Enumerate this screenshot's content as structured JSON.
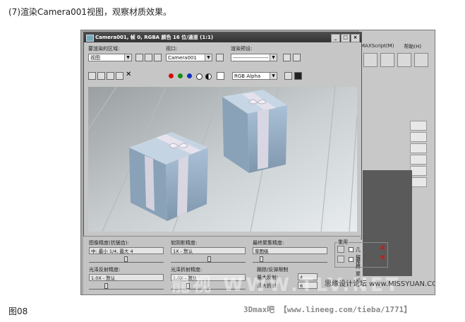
{
  "article": {
    "step_caption": "(7)渲染Camera001视图，观察材质效果。",
    "figure_caption": "图08",
    "footer_link": "3Dmax吧 【www.lineeg.com/tieba/1771】"
  },
  "background_app": {
    "menu": [
      "MAXScript(M)",
      "帮助(H)"
    ]
  },
  "render_window": {
    "title": "Camera001, 帧 0, RGBA 颜色 16 位/通道 (1:1)",
    "area_label": "要渲染的区域:",
    "area_value": "视图",
    "viewport_label": "视口:",
    "viewport_value": "Camera001",
    "preset_label": "渲染预设:",
    "preset_value": "--------------------",
    "channel_value": "RGB Alpha"
  },
  "settings": {
    "image_precision_label": "图像精度(抗锯齿):",
    "image_precision_value": "中: 最小 1/4, 最大 4",
    "soft_shadow_label": "软阴影精度:",
    "soft_shadow_value": "1X - 默认",
    "final_gather_label": "最终聚集精度:",
    "final_gather_value": "草图级",
    "reflection_label": "光泽反射精度:",
    "reflection_value": "1.0X - 默认",
    "refraction_label": "光泽折射精度:",
    "refraction_value": "1.0X - 默认",
    "trace_label": "跟踪/反弹限制",
    "max_reflection_label": "最大反射:",
    "max_reflection_value": "4",
    "max_refraction_label": "最大折射:",
    "max_refraction_value": "6",
    "reuse_label": "重用",
    "geometry_label": "几何体",
    "final_gather_reuse_label": "最终聚集"
  },
  "watermarks": {
    "main": "龍视 WWW.TLV.NET",
    "forum": "思缘设计论坛 www.MISSYUAN.COM"
  }
}
